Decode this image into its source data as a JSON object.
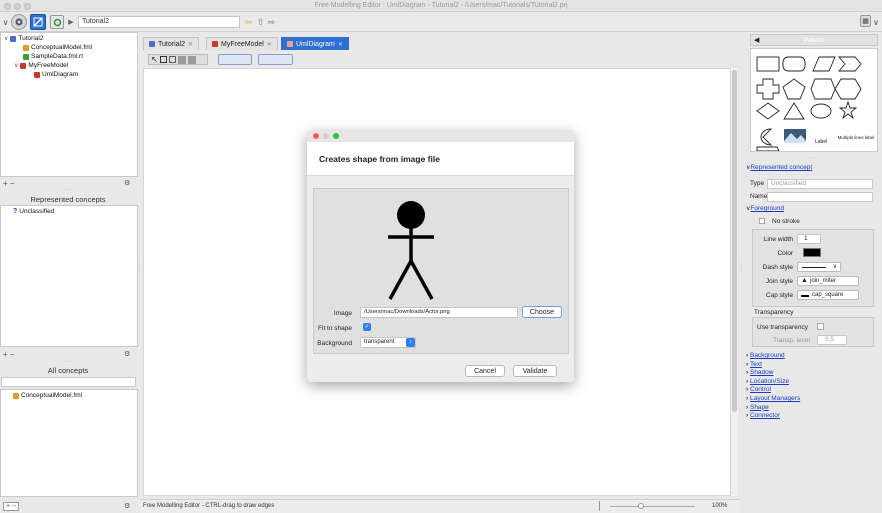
{
  "window": {
    "title": "Free Modelling Editor : UmlDiagram - Tutorial2 - /Users/mac/Tutorials/Tutorial2.prj"
  },
  "toolbar": {
    "path": "Tutorial2"
  },
  "project_tree": [
    {
      "label": "Tutorial2",
      "icon": "project-icon",
      "color": "#4a6fc7"
    },
    {
      "label": "ConceptualModel.fml",
      "icon": "model-icon",
      "color": "#e39b20"
    },
    {
      "label": "SampleData.fml.rt",
      "icon": "data-icon",
      "color": "#3d9a3d"
    },
    {
      "label": "MyFreeModel",
      "icon": "model-icon",
      "color": "#c53a2a"
    },
    {
      "label": "UmlDiagram",
      "icon": "diagram-icon",
      "color": "#c53a2a"
    }
  ],
  "represented_concepts": {
    "title": "Represented concepts",
    "items": [
      "Unclassified"
    ]
  },
  "all_concepts": {
    "title": "All concepts",
    "items": [
      "ConceptualModel.fml"
    ]
  },
  "tabs": [
    {
      "label": "Tutorial2",
      "active": false
    },
    {
      "label": "MyFreeModel",
      "active": false
    },
    {
      "label": "UmlDiagram",
      "active": true
    }
  ],
  "status": {
    "text": "Free Modelling Editor - CTRL-drag to draw edges",
    "zoom": "100%"
  },
  "dialog": {
    "heading": "Creates shape from image file",
    "image_label": "Image",
    "image_path": "/Users/mac/Downloads/Actor.png",
    "choose_label": "Choose",
    "fit_label": "Fit to shape",
    "fit_checked": true,
    "background_label": "Background",
    "background_value": "transparent",
    "cancel_label": "Cancel",
    "validate_label": "Validate"
  },
  "palette": {
    "title": "Palette",
    "text_items": [
      "Label",
      "Multiple lines label"
    ]
  },
  "inspector": {
    "represented_concept": "Represented concept",
    "type_label": "Type",
    "type_value": "Unclassified",
    "name_label": "Name",
    "foreground": "Foreground",
    "no_stroke": "No stroke",
    "line_width_label": "Line width",
    "line_width_value": "1",
    "color_label": "Color",
    "dash_style_label": "Dash style",
    "join_style_label": "Join style",
    "join_style_value": "join_miter",
    "cap_style_label": "Cap style",
    "cap_style_value": "cap_square",
    "transparency": "Transparency",
    "use_transparency": "Use transparency",
    "transp_level_label": "Transp. level",
    "transp_level_value": "0.5",
    "sections": [
      "Background",
      "Text",
      "Shadow",
      "Location/Size",
      "Control",
      "Layout Managers",
      "Shape",
      "Connector"
    ]
  },
  "colors": {
    "accent": "#2f6fd0",
    "link": "#1a3cc0"
  }
}
